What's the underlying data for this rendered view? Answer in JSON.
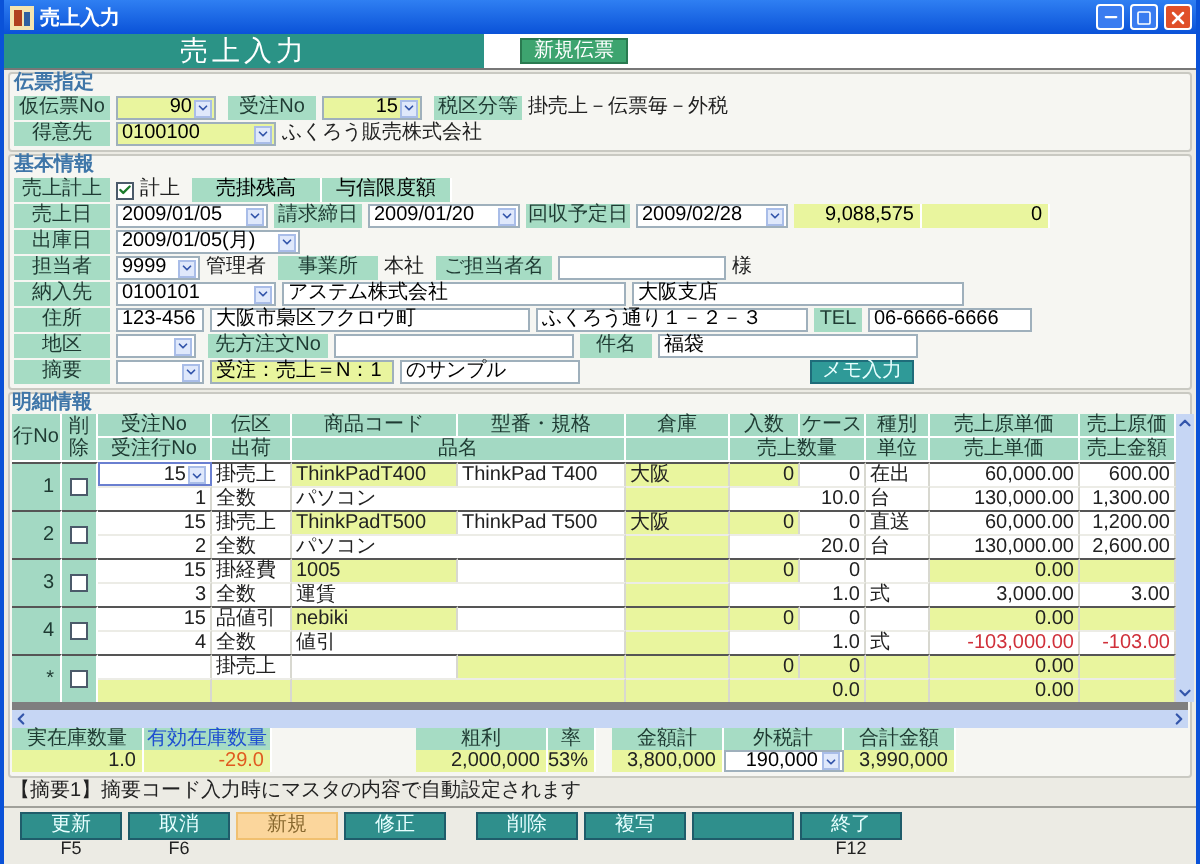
{
  "window": {
    "title": "売上入力"
  },
  "header": {
    "title": "売上入力",
    "new_slip_button": "新規伝票"
  },
  "slip": {
    "legend": "伝票指定",
    "temp_no_label": "仮伝票No",
    "temp_no": "90",
    "order_no_label": "受注No",
    "order_no": "15",
    "tax_label": "税区分等",
    "tax": "掛売上－伝票毎－外税",
    "customer_label": "得意先",
    "customer_code": "0100100",
    "customer_name": "ふくろう販売株式会社"
  },
  "basic": {
    "legend": "基本情報",
    "post_label": "売上計上",
    "post_checked": true,
    "post_text": "計上",
    "balance_label": "売掛残高",
    "balance": "9,088,575",
    "credit_label": "与信限度額",
    "credit": "0",
    "sales_date_label": "売上日",
    "sales_date": "2009/01/05",
    "closing_label": "請求締日",
    "closing": "2009/01/20",
    "collect_label": "回収予定日",
    "collect": "2009/02/28",
    "ship_label": "出庫日",
    "ship": "2009/01/05(月)",
    "staff_label": "担当者",
    "staff_code": "9999",
    "staff_name": "管理者",
    "office_label": "事業所",
    "office": "本社",
    "contact_label": "ご担当者名",
    "contact_suffix": "様",
    "dest_label": "納入先",
    "dest_code": "0100101",
    "dest_name": "アステム株式会社",
    "dest_branch": "大阪支店",
    "addr_label": "住所",
    "zip": "123-456",
    "addr1": "大阪市梟区フクロウ町",
    "addr2": "ふくろう通り１－２－３",
    "tel_label": "TEL",
    "tel": "06-6666-6666",
    "area_label": "地区",
    "po_label": "先方注文No",
    "subject_label": "件名",
    "subject": "福袋",
    "memo_label": "摘要",
    "memo1": "受注：売上＝N：1",
    "memo2": "のサンプル",
    "memo_button": "メモ入力"
  },
  "details": {
    "legend": "明細情報",
    "header_top": [
      "行No",
      "削除",
      "受注No",
      "伝区",
      "商品コード",
      "型番・規格",
      "倉庫",
      "入数",
      "ケース",
      "種別",
      "売上原単価",
      "売上原価"
    ],
    "header_bottom": [
      "受注行No",
      "出荷",
      "品名",
      "売上数量",
      "単位",
      "売上単価",
      "売上金額"
    ],
    "rows": [
      {
        "row_no": "1",
        "deleted": false,
        "selected": true,
        "top": [
          {
            "text": "15",
            "highlighted": false
          },
          {
            "text": "掛売上",
            "highlighted": false
          },
          {
            "text": "ThinkPadT400",
            "highlighted": true
          },
          {
            "text": "ThinkPad T400",
            "highlighted": false
          },
          {
            "text": "大阪",
            "highlighted": true
          },
          {
            "text": "0",
            "highlighted": true
          },
          {
            "text": "0",
            "highlighted": false
          },
          {
            "text": "在出",
            "highlighted": false
          },
          {
            "text": "60,000.00",
            "highlighted": false
          },
          {
            "text": "600.00",
            "highlighted": false
          }
        ],
        "bottom": [
          {
            "text": "1",
            "highlighted": false
          },
          {
            "text": "全数",
            "highlighted": false
          },
          {
            "text": "パソコン",
            "highlighted": false
          },
          {
            "highlighted": true
          },
          {
            "text": "10.0",
            "highlighted": false
          },
          {
            "text": "台",
            "highlighted": false
          },
          {
            "text": "130,000.00",
            "highlighted": false
          },
          {
            "text": "1,300.00",
            "highlighted": false
          }
        ]
      },
      {
        "row_no": "2",
        "deleted": false,
        "selected": false,
        "top": [
          {
            "text": "15",
            "highlighted": false
          },
          {
            "text": "掛売上",
            "highlighted": false
          },
          {
            "text": "ThinkPadT500",
            "highlighted": true
          },
          {
            "text": "ThinkPad T500",
            "highlighted": false
          },
          {
            "text": "大阪",
            "highlighted": true
          },
          {
            "text": "0",
            "highlighted": true
          },
          {
            "text": "0",
            "highlighted": false
          },
          {
            "text": "直送",
            "highlighted": false
          },
          {
            "text": "60,000.00",
            "highlighted": false
          },
          {
            "text": "1,200.00",
            "highlighted": false
          }
        ],
        "bottom": [
          {
            "text": "2",
            "highlighted": false
          },
          {
            "text": "全数",
            "highlighted": false
          },
          {
            "text": "パソコン",
            "highlighted": false
          },
          {
            "highlighted": true
          },
          {
            "text": "20.0",
            "highlighted": false
          },
          {
            "text": "台",
            "highlighted": false
          },
          {
            "text": "130,000.00",
            "highlighted": false
          },
          {
            "text": "2,600.00",
            "highlighted": false
          }
        ]
      },
      {
        "row_no": "3",
        "deleted": false,
        "selected": false,
        "top": [
          {
            "text": "15",
            "highlighted": false
          },
          {
            "text": "掛経費",
            "highlighted": false
          },
          {
            "text": "1005",
            "highlighted": true
          },
          {
            "highlighted": false
          },
          {
            "highlighted": true
          },
          {
            "text": "0",
            "highlighted": true
          },
          {
            "text": "0",
            "highlighted": false
          },
          {
            "highlighted": false
          },
          {
            "text": "0.00",
            "highlighted": true
          },
          {
            "highlighted": true
          }
        ],
        "bottom": [
          {
            "text": "3",
            "highlighted": false
          },
          {
            "text": "全数",
            "highlighted": false
          },
          {
            "text": "運賃",
            "highlighted": false
          },
          {
            "highlighted": true
          },
          {
            "text": "1.0",
            "highlighted": false
          },
          {
            "text": "式",
            "highlighted": false
          },
          {
            "text": "3,000.00",
            "highlighted": false
          },
          {
            "text": "3.00",
            "highlighted": false
          }
        ]
      },
      {
        "row_no": "4",
        "deleted": false,
        "selected": false,
        "top": [
          {
            "text": "15",
            "highlighted": false
          },
          {
            "text": "品値引",
            "highlighted": false
          },
          {
            "text": "nebiki",
            "highlighted": true
          },
          {
            "highlighted": false
          },
          {
            "highlighted": true
          },
          {
            "text": "0",
            "highlighted": true
          },
          {
            "text": "0",
            "highlighted": false
          },
          {
            "highlighted": false
          },
          {
            "text": "0.00",
            "highlighted": true
          },
          {
            "highlighted": true
          }
        ],
        "bottom": [
          {
            "text": "4",
            "highlighted": false
          },
          {
            "text": "全数",
            "highlighted": false
          },
          {
            "text": "値引",
            "highlighted": false
          },
          {
            "highlighted": true
          },
          {
            "text": "1.0",
            "highlighted": false
          },
          {
            "text": "式",
            "highlighted": false
          },
          {
            "text": "-103,000.00",
            "highlighted": false,
            "negative": true
          },
          {
            "text": "-103.00",
            "highlighted": false,
            "negative": true
          }
        ]
      },
      {
        "row_no": "*",
        "deleted": false,
        "selected": false,
        "top": [
          {
            "highlighted": false
          },
          {
            "text": "掛売上",
            "highlighted": false
          },
          {
            "highlighted": false
          },
          {
            "highlighted": true
          },
          {
            "highlighted": true
          },
          {
            "text": "0",
            "highlighted": true
          },
          {
            "text": "0",
            "highlighted": true
          },
          {
            "highlighted": true
          },
          {
            "text": "0.00",
            "highlighted": true
          },
          {
            "highlighted": true
          }
        ],
        "bottom": [
          {
            "highlighted": true
          },
          {
            "highlighted": true
          },
          {
            "highlighted": true
          },
          {
            "highlighted": true
          },
          {
            "text": "0.0",
            "highlighted": true
          },
          {
            "highlighted": true
          },
          {
            "text": "0.00",
            "highlighted": true
          },
          {
            "highlighted": true
          }
        ]
      }
    ]
  },
  "totals": {
    "actual_stock_label": "実在庫数量",
    "actual_stock": "1.0",
    "available_stock_label": "有効在庫数量",
    "available_stock": "-29.0",
    "gross_profit_label": "粗利",
    "gross_profit": "2,000,000",
    "rate_label": "率",
    "rate": "53%",
    "amount_label": "金額計",
    "amount": "3,800,000",
    "tax_label": "外税計",
    "tax": "190,000",
    "grand_total_label": "合計金額",
    "grand_total": "3,990,000"
  },
  "message": "【摘要1】摘要コード入力時にマスタの内容で自動設定されます",
  "buttons": [
    {
      "kind": "action",
      "label": "更新",
      "key": "F5"
    },
    {
      "kind": "action",
      "label": "取消",
      "key": "F6"
    },
    {
      "kind": "current",
      "label": "新規"
    },
    {
      "kind": "action",
      "label": "修正"
    },
    {
      "kind": "action",
      "label": "削除"
    },
    {
      "kind": "action",
      "label": "複写"
    },
    {
      "kind": "blank"
    },
    {
      "kind": "action",
      "label": "終了",
      "key": "F12"
    }
  ]
}
